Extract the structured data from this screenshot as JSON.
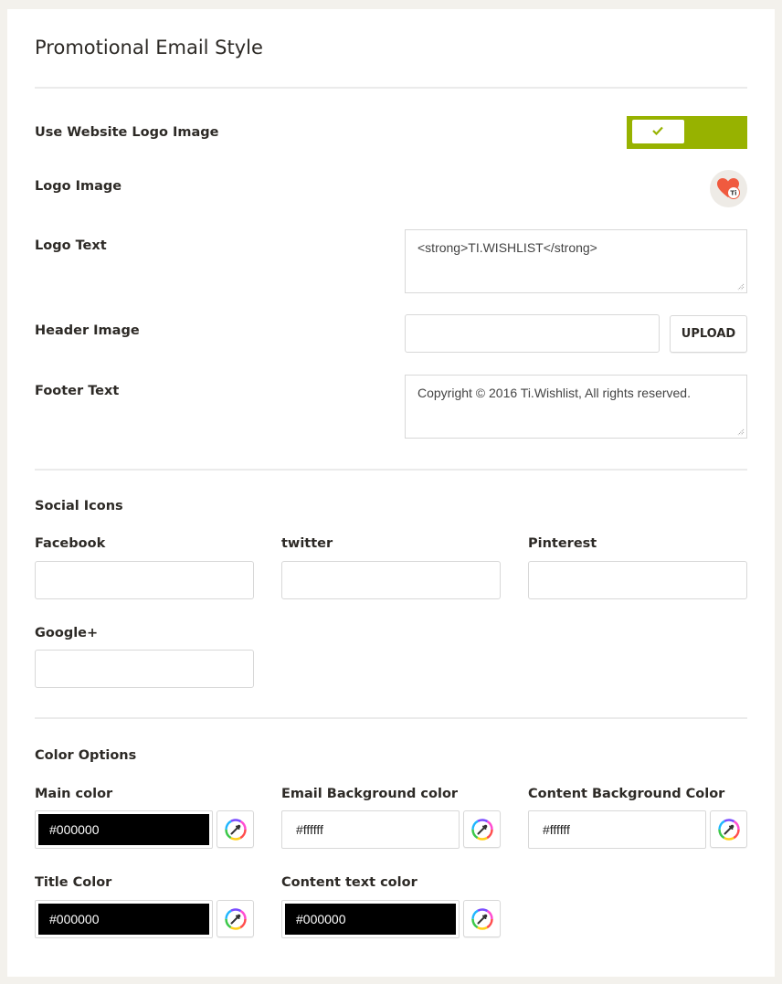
{
  "page": {
    "title": "Promotional Email Style"
  },
  "general": {
    "use_logo_label": "Use Website Logo Image",
    "use_logo_enabled": true,
    "logo_image_label": "Logo Image",
    "logo_badge_text": "Ti",
    "logo_text_label": "Logo Text",
    "logo_text_value": "<strong>TI.WISHLIST</strong>",
    "header_image_label": "Header Image",
    "header_image_value": "",
    "upload_label": "UPLOAD",
    "footer_text_label": "Footer Text",
    "footer_text_value": "Copyright © 2016 Ti.Wishlist, All rights reserved."
  },
  "social": {
    "section_title": "Social Icons",
    "facebook_label": "Facebook",
    "twitter_label": "twitter",
    "pinterest_label": "Pinterest",
    "google_label": "Google+"
  },
  "colors": {
    "section_title": "Color Options",
    "main_label": "Main color",
    "main_value": "#000000",
    "email_bg_label": "Email Background color",
    "email_bg_value": "#ffffff",
    "content_bg_label": "Content Background Color",
    "content_bg_value": "#ffffff",
    "title_label": "Title Color",
    "title_value": "#000000",
    "content_text_label": "Content text color",
    "content_text_value": "#000000"
  },
  "theme": {
    "accent": "#97b200",
    "page_bg": "#f3f1ec",
    "logo_heart": "#f05a3f"
  }
}
